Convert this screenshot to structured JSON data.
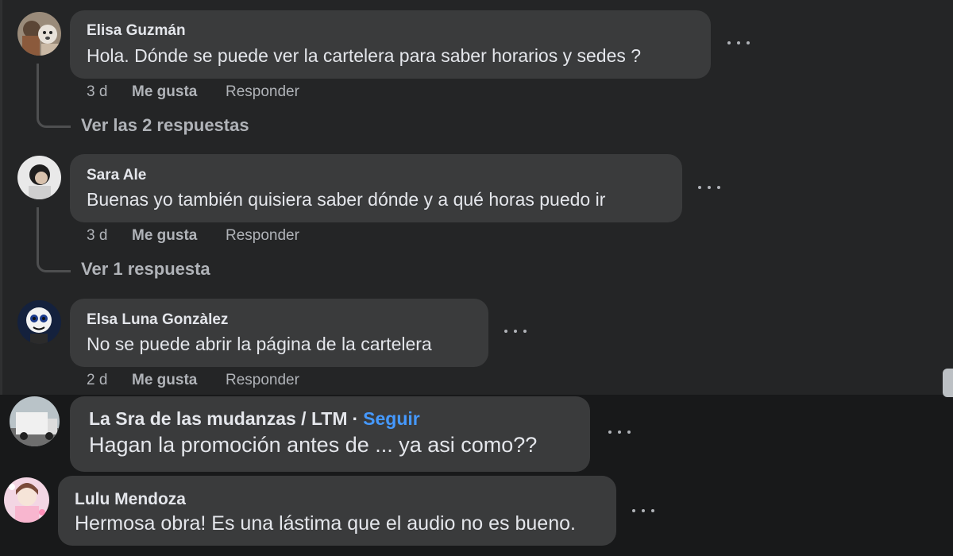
{
  "comments": [
    {
      "author": "Elisa Guzmán",
      "text": "Hola. Dónde se puede ver la cartelera para saber horarios y sedes ?",
      "time": "3 d",
      "like": "Me gusta",
      "reply": "Responder",
      "view_replies": "Ver las 2 respuestas"
    },
    {
      "author": "Sara Ale",
      "text": "Buenas yo también quisiera saber dónde y a qué horas puedo ir",
      "time": "3 d",
      "like": "Me gusta",
      "reply": "Responder",
      "view_replies": "Ver 1 respuesta"
    },
    {
      "author": "Elsa Luna Gonzàlez",
      "text": "No se puede abrir la página de la cartelera",
      "time": "2 d",
      "like": "Me gusta",
      "reply": "Responder"
    },
    {
      "author": "La Sra de las mudanzas / LTM",
      "separator": "·",
      "follow": "Seguir",
      "text": "Hagan la promoción antes de ... ya asi como??"
    },
    {
      "author": "Lulu Mendoza",
      "text": "Hermosa obra! Es una lástima que el audio no es bueno."
    }
  ]
}
